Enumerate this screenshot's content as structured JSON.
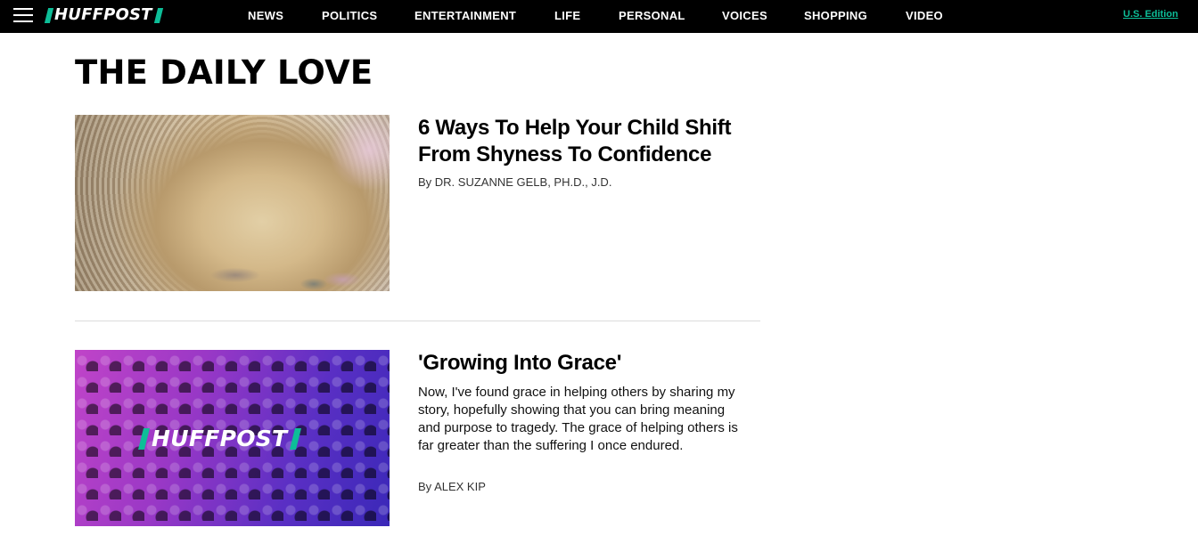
{
  "header": {
    "logo_text": "HUFFPOST",
    "nav": [
      "NEWS",
      "POLITICS",
      "ENTERTAINMENT",
      "LIFE",
      "PERSONAL",
      "VOICES",
      "SHOPPING",
      "VIDEO"
    ],
    "edition": "U.S. Edition"
  },
  "page": {
    "title": "THE DAILY LOVE"
  },
  "articles": [
    {
      "headline": "6 Ways To Help Your Child Shift From Shyness To Confidence",
      "byline": "By DR. SUZANNE GELB, PH.D., J.D.",
      "description": ""
    },
    {
      "headline": "'Growing Into Grace'",
      "byline": "By ALEX KIP",
      "description": "Now, I've found grace in helping others by sharing my story, hopefully showing that you can bring meaning and purpose to tragedy. The grace of helping others is far greater than the suffering I once endured.",
      "image_logo_text": "HUFFPOST"
    }
  ],
  "colors": {
    "brand_accent": "#0dbe98",
    "topbar_bg": "#000000"
  }
}
